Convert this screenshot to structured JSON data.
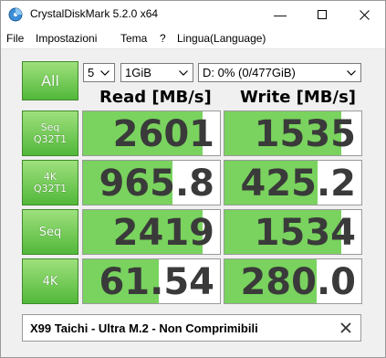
{
  "window": {
    "title": "CrystalDiskMark 5.2.0 x64",
    "min_glyph": "—",
    "max_glyph": "☐",
    "close_glyph": "✕"
  },
  "menu": [
    "File",
    "Impostazioni",
    "Tema",
    "?",
    "Lingua(Language)"
  ],
  "toolbar": {
    "all_label": "All",
    "count_value": "5",
    "size_value": "1GiB",
    "drive_value": "D: 0% (0/477GiB)"
  },
  "headers": {
    "read": "Read [MB/s]",
    "write": "Write [MB/s]"
  },
  "rows": [
    {
      "label_line1": "Seq",
      "label_line2": "Q32T1",
      "read": "2601",
      "write": "1535",
      "read_fill": 0.87,
      "write_fill": 0.85
    },
    {
      "label_line1": "4K",
      "label_line2": "Q32T1",
      "read": "965.8",
      "write": "425.2",
      "read_fill": 0.65,
      "write_fill": 0.68
    },
    {
      "label_line1": "Seq",
      "label_line2": "",
      "read": "2419",
      "write": "1534",
      "read_fill": 0.87,
      "write_fill": 0.85
    },
    {
      "label_line1": "4K",
      "label_line2": "",
      "read": "61.54",
      "write": "280.0",
      "read_fill": 0.55,
      "write_fill": 0.67
    }
  ],
  "comment": {
    "text": "X99 Taichi - Ultra M.2 - Non Comprimibili",
    "close_glyph": "✕"
  },
  "colors": {
    "accent_green": "#5cbf41",
    "bar_green": "#79d35e"
  },
  "icons": [
    "app-disk-icon",
    "dropdown-arrow-icon",
    "close-icon"
  ]
}
